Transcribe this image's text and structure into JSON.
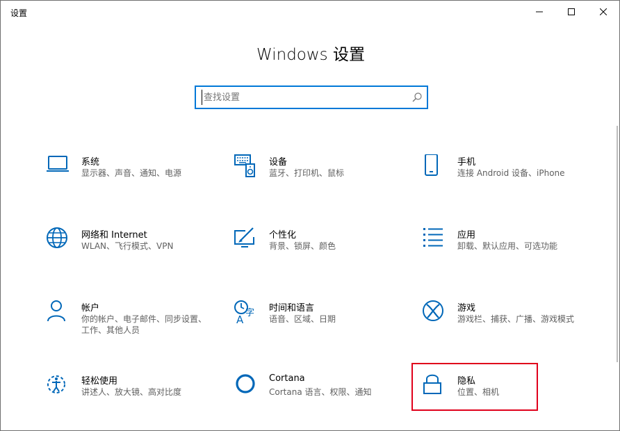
{
  "window": {
    "title": "设置"
  },
  "header": {
    "title": "Windows 设置"
  },
  "search": {
    "placeholder": "查找设置",
    "value": ""
  },
  "tiles": [
    {
      "name": "系统",
      "desc": "显示器、声音、通知、电源",
      "icon": "laptop-icon"
    },
    {
      "name": "设备",
      "desc": "蓝牙、打印机、鼠标",
      "icon": "keyboard-speaker-icon"
    },
    {
      "name": "手机",
      "desc": "连接 Android 设备、iPhone",
      "icon": "phone-icon"
    },
    {
      "name": "网络和 Internet",
      "desc": "WLAN、飞行模式、VPN",
      "icon": "globe-icon"
    },
    {
      "name": "个性化",
      "desc": "背景、锁屏、颜色",
      "icon": "paint-monitor-icon"
    },
    {
      "name": "应用",
      "desc": "卸载、默认应用、可选功能",
      "icon": "app-list-icon"
    },
    {
      "name": "帐户",
      "desc": "你的帐户、电子邮件、同步设置、工作、其他人员",
      "icon": "person-icon"
    },
    {
      "name": "时间和语言",
      "desc": "语音、区域、日期",
      "icon": "time-language-icon"
    },
    {
      "name": "游戏",
      "desc": "游戏栏、捕获、广播、游戏模式",
      "icon": "xbox-icon"
    },
    {
      "name": "轻松使用",
      "desc": "讲述人、放大镜、高对比度",
      "icon": "ease-of-access-icon"
    },
    {
      "name": "Cortana",
      "desc": "Cortana 语言、权限、通知",
      "icon": "cortana-icon"
    },
    {
      "name": "隐私",
      "desc": "位置、相机",
      "icon": "lock-icon"
    }
  ],
  "colors": {
    "accent": "#0078d7",
    "highlight": "#e0001b"
  }
}
